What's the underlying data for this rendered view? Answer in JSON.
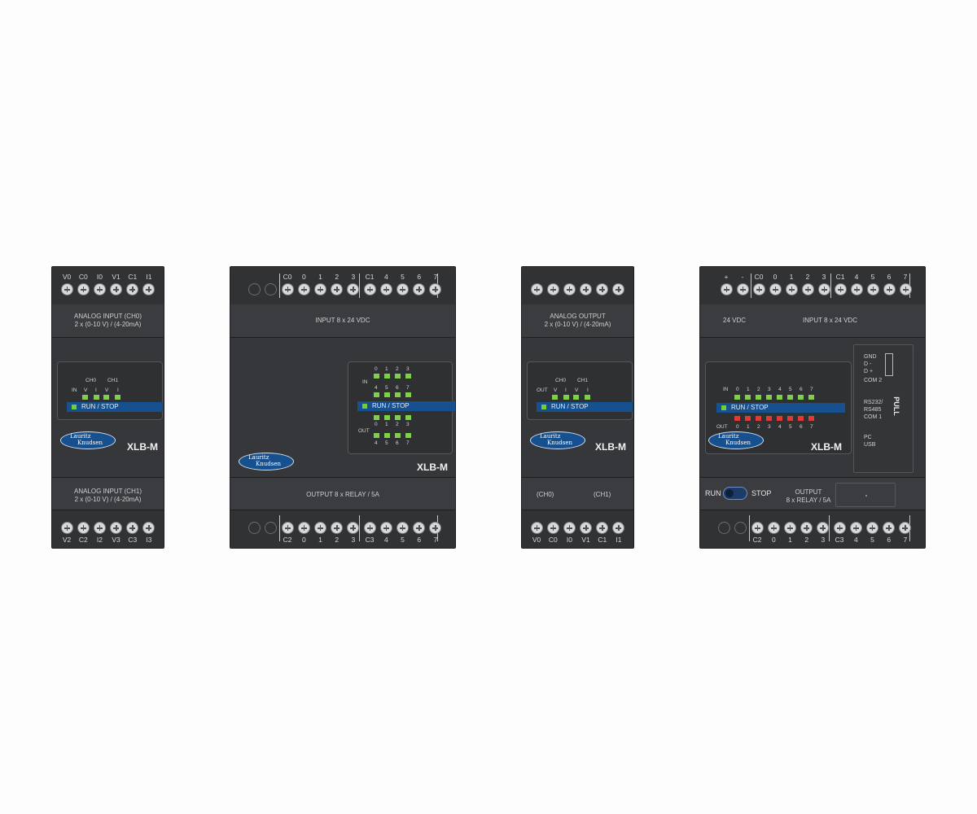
{
  "modules": {
    "m1": {
      "top_terminals": [
        "V0",
        "C0",
        "I0",
        "V1",
        "C1",
        "I1"
      ],
      "top_band": [
        "ANALOG INPUT (CH0)",
        "2 x (0-10 V) / (4-20mA)"
      ],
      "bottom_band": [
        "ANALOG INPUT (CH1)",
        "2 x (0-10 V) / (4-20mA)"
      ],
      "bottom_terminals": [
        "V2",
        "C2",
        "I2",
        "V3",
        "C3",
        "I3"
      ],
      "io_label": "IN",
      "ch_labels": [
        "CH0",
        "CH1"
      ],
      "vi_labels": [
        "V",
        "I",
        "V",
        "I"
      ],
      "run_stop": "RUN / STOP",
      "brand": [
        "Lauritz",
        "Knudsen"
      ],
      "model": "XLB-M"
    },
    "m2": {
      "top_terminals": [
        "C0",
        "0",
        "1",
        "2",
        "3",
        "C1",
        "4",
        "5",
        "6",
        "7"
      ],
      "top_band": "INPUT 8 x 24 VDC",
      "bottom_band": "OUTPUT 8 x RELAY / 5A",
      "bottom_terminals": [
        "C2",
        "0",
        "1",
        "2",
        "3",
        "C3",
        "4",
        "5",
        "6",
        "7"
      ],
      "in_label": "IN",
      "out_label": "OUT",
      "led_row_a": [
        "0",
        "1",
        "2",
        "3"
      ],
      "led_row_b": [
        "4",
        "5",
        "6",
        "7"
      ],
      "run_stop": "RUN / STOP",
      "brand": [
        "Lauritz",
        "Knudsen"
      ],
      "model": "XLB-M"
    },
    "m3": {
      "top_band": [
        "ANALOG OUTPUT",
        "2 x (0-10 V) / (4-20mA)"
      ],
      "bottom_band": [
        "(CH0)",
        "(CH1)"
      ],
      "bottom_terminals": [
        "V0",
        "C0",
        "I0",
        "V1",
        "C1",
        "I1"
      ],
      "io_label": "OUT",
      "ch_labels": [
        "CH0",
        "CH1"
      ],
      "vi_labels": [
        "V",
        "I",
        "V",
        "I"
      ],
      "run_stop": "RUN / STOP",
      "brand": [
        "Lauritz",
        "Knudsen"
      ],
      "model": "XLB-M"
    },
    "m4": {
      "top_terminals": [
        "+",
        "-",
        "C0",
        "0",
        "1",
        "2",
        "3",
        "C1",
        "4",
        "5",
        "6",
        "7"
      ],
      "top_band": [
        "24 VDC",
        "INPUT 8 x 24 VDC"
      ],
      "in_label": "IN",
      "out_label": "OUT",
      "led_numbers": [
        "0",
        "1",
        "2",
        "3",
        "4",
        "5",
        "6",
        "7"
      ],
      "run_stop": "RUN / STOP",
      "brand": [
        "Lauritz",
        "Knudsen"
      ],
      "model": "XLB-M",
      "com2": [
        "GND",
        "D -",
        "D +",
        "COM 2"
      ],
      "com1": [
        "RS232/",
        "RS485",
        "COM 1"
      ],
      "pc": [
        "PC",
        "USB"
      ],
      "pull": "PULL",
      "switch": [
        "RUN",
        "STOP"
      ],
      "output": [
        "OUTPUT",
        "8 x RELAY / 5A"
      ],
      "bottom_terminals": [
        "C2",
        "0",
        "1",
        "2",
        "3",
        "C3",
        "4",
        "5",
        "6",
        "7"
      ]
    }
  },
  "colors": {
    "housing": "#35373a",
    "led_green": "#7ed04b",
    "led_red": "#e03a35",
    "brand_blue": "#17508f"
  }
}
